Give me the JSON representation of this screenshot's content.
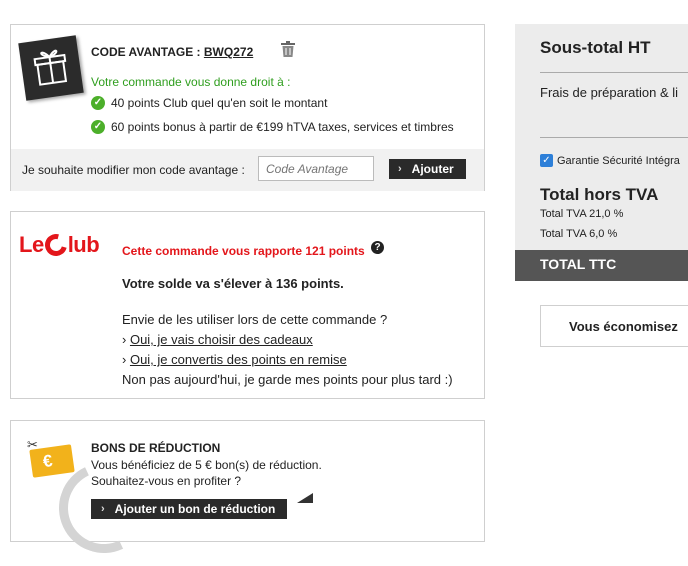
{
  "code": {
    "title_prefix": "CODE AVANTAGE : ",
    "code_value": "BWQ272",
    "intro": "Votre commande vous donne droit à :",
    "benefits": [
      "40 points Club quel qu'en soit le montant",
      "60 points bonus à partir de €199 hTVA taxes, services et timbres"
    ],
    "modify_label": "Je souhaite modifier mon code avantage :",
    "input_placeholder": "Code Avantage",
    "add_button": "Ajouter"
  },
  "club": {
    "logo_left": "Le",
    "logo_right": "lub",
    "points_message": "Cette commande vous rapporte 121 points",
    "help": "?",
    "balance": "Votre solde va s'élever à 136 points.",
    "question": "Envie de les utiliser lors de cette commande ?",
    "options": [
      "Oui, je vais choisir des cadeaux",
      "Oui, je convertis des points en remise"
    ],
    "decline": "Non pas aujourd'hui, je garde mes points pour plus tard :)"
  },
  "bons": {
    "title": "BONS DE RÉDUCTION",
    "line1": "Vous bénéficiez de 5 € bon(s) de réduction.",
    "line2": "Souhaitez-vous en profiter ?",
    "button": "Ajouter un bon de réduction",
    "voucher_symbol": "€"
  },
  "summary": {
    "subtotal": "Sous-total HT",
    "frais": "Frais de préparation & li",
    "guarantee": "Garantie Sécurité Intégra",
    "total_ht": "Total hors TVA",
    "tva1": "Total TVA 21,0 %",
    "tva2": "Total TVA 6,0 %",
    "ttc": "TOTAL TTC",
    "savings": "Vous économisez"
  },
  "colors": {
    "accent_red": "#e3161b",
    "accent_green": "#2f9e1e",
    "voucher_yellow": "#f2b21b",
    "checkbox_blue": "#2d7fd8"
  }
}
